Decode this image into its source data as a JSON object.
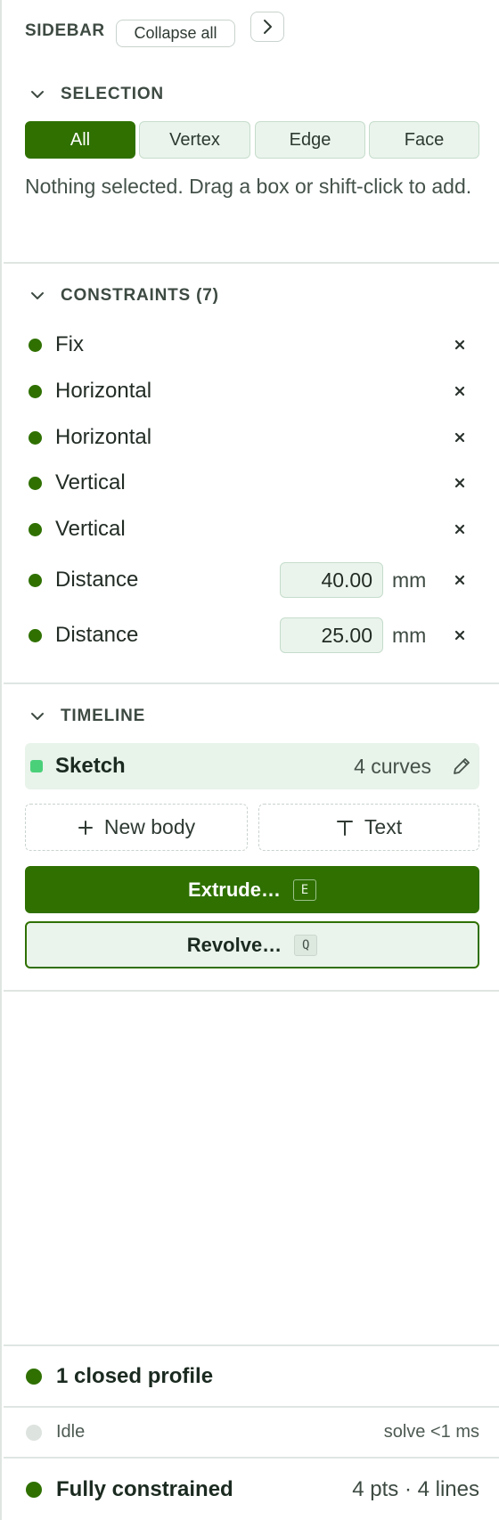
{
  "sidebar": {
    "title": "SIDEBAR",
    "collapse_all_label": "Collapse all"
  },
  "selection": {
    "heading": "SELECTION",
    "modes": [
      {
        "label": "All",
        "active": true
      },
      {
        "label": "Vertex",
        "active": false
      },
      {
        "label": "Edge",
        "active": false
      },
      {
        "label": "Face",
        "active": false
      }
    ],
    "hint": "Nothing selected. Drag a box or shift-click to add."
  },
  "constraints": {
    "heading": "CONSTRAINTS (7)",
    "items": [
      {
        "label": "Fix"
      },
      {
        "label": "Horizontal"
      },
      {
        "label": "Horizontal"
      },
      {
        "label": "Vertical"
      },
      {
        "label": "Vertical"
      },
      {
        "label": "Distance",
        "value": "40.00",
        "unit": "mm"
      },
      {
        "label": "Distance",
        "value": "25.00",
        "unit": "mm"
      }
    ]
  },
  "timeline": {
    "heading": "TIMELINE",
    "item": {
      "name": "Sketch",
      "meta": "4 curves"
    },
    "new_body_label": "New body",
    "text_label": "Text",
    "extrude_label": "Extrude…",
    "extrude_key": "E",
    "revolve_label": "Revolve…",
    "revolve_key": "Q"
  },
  "status": {
    "profile": "1 closed profile",
    "solver_state": "Idle",
    "solve_time": "solve <1 ms",
    "constraint_state": "Fully constrained",
    "counts": "4 pts · 4 lines"
  },
  "colors": {
    "accent": "#2f7000",
    "accent_light": "#eaf4ec",
    "sketch_marker": "#4bd07a",
    "idle_dot": "#dde3df",
    "divider": "#dfe6e2"
  }
}
